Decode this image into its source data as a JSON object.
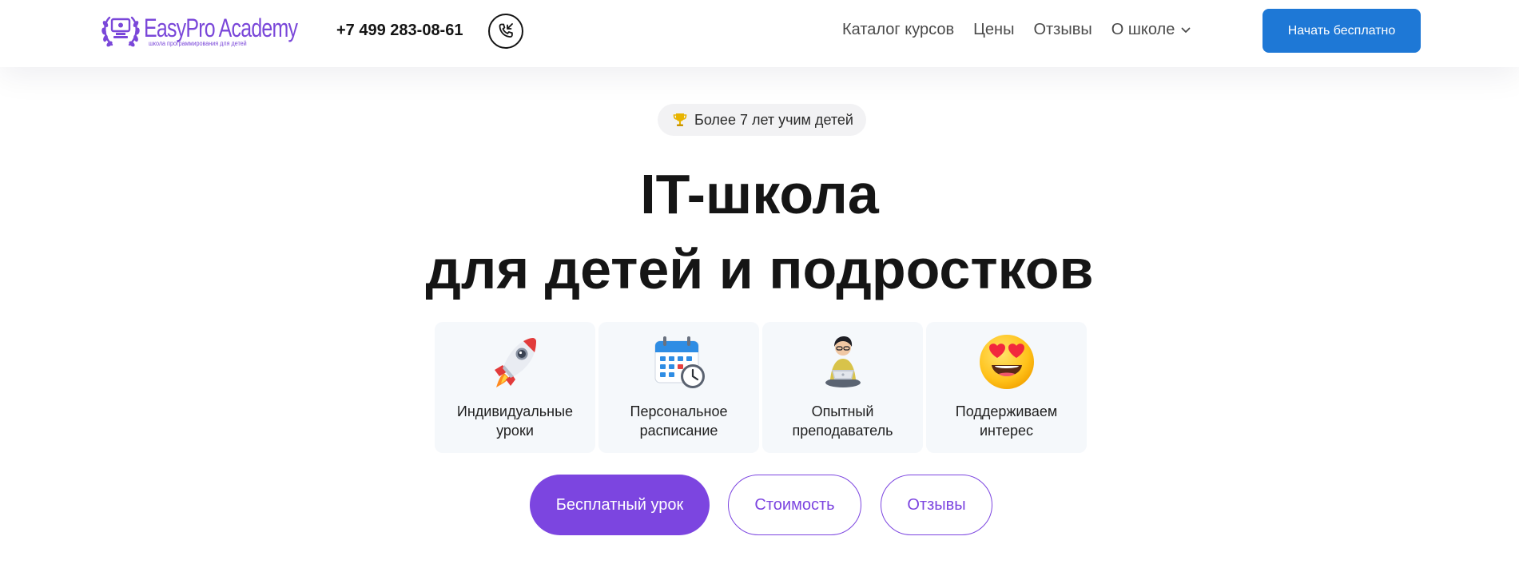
{
  "header": {
    "logo_name": "EasyPro Academy",
    "logo_tagline": "школа программирования для детей",
    "phone": "+7 499 283-08-61",
    "nav": [
      {
        "label": "Каталог курсов"
      },
      {
        "label": "Цены"
      },
      {
        "label": "Отзывы"
      },
      {
        "label": "О школе"
      }
    ],
    "cta_label": "Начать бесплатно"
  },
  "hero": {
    "badge": "Более 7 лет учим детей",
    "title_line1": "IT-школа",
    "title_line2": "для детей и подростков",
    "features": [
      {
        "line1": "Индивидуальные",
        "line2": "уроки",
        "icon": "rocket-icon"
      },
      {
        "line1": "Персональное",
        "line2": "расписание",
        "icon": "calendar-clock-icon"
      },
      {
        "line1": "Опытный",
        "line2": "преподаватель",
        "icon": "teacher-laptop-icon"
      },
      {
        "line1": "Поддерживаем",
        "line2": "интерес",
        "icon": "heart-eyes-emoji-icon"
      }
    ],
    "buttons": {
      "free_lesson": "Бесплатный урок",
      "price": "Стоимость",
      "reviews": "Отзывы"
    }
  },
  "colors": {
    "brand_purple": "#7c45e0",
    "header_cta_blue": "#1e78d6",
    "feature_card_bg": "#f5f8fb",
    "badge_bg": "#f2f2f4"
  }
}
